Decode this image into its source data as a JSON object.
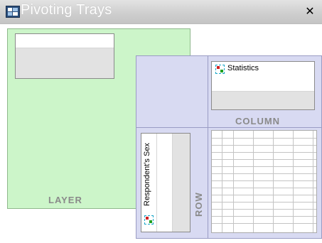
{
  "window": {
    "title": "Pivoting Trays",
    "close_symbol": "✕"
  },
  "trays": {
    "layer": {
      "label": "LAYER",
      "items": []
    },
    "column": {
      "label": "COLUMN",
      "items": [
        {
          "label": "Statistics",
          "icon": "pivot-variable-icon"
        }
      ]
    },
    "row": {
      "label": "ROW",
      "items": [
        {
          "label": "Respondent's Sex",
          "icon": "pivot-variable-icon"
        }
      ]
    }
  },
  "colors": {
    "layer_tray_bg": "#ccf5c9",
    "pivot_area_bg": "#d8daf2",
    "tray_label": "#8a8a8a"
  }
}
